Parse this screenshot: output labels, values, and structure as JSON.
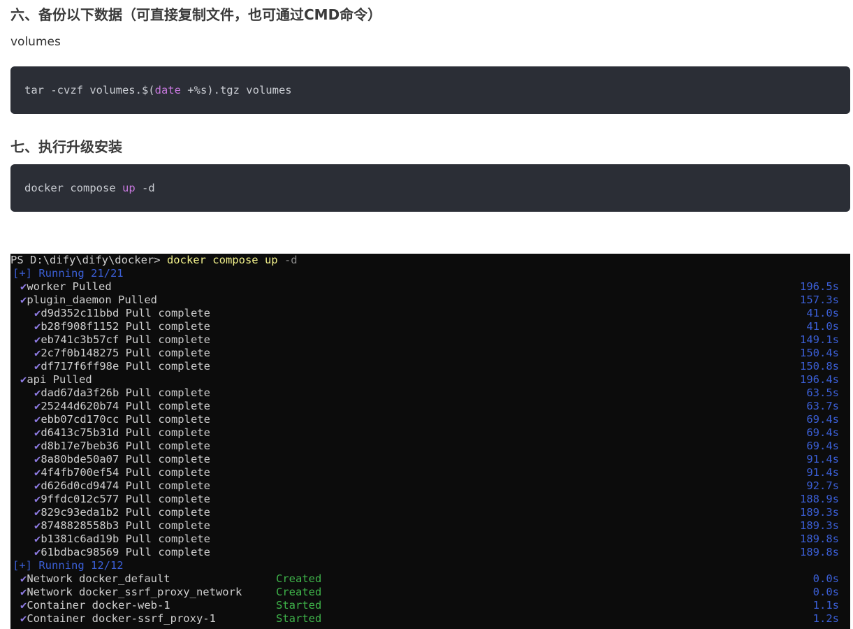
{
  "sections": {
    "six_heading": "六、备份以下数据（可直接复制文件，也可通过CMD命令）",
    "six_para": "volumes",
    "six_code": {
      "before": "tar -cvzf volumes.$(",
      "keyword": "date",
      "after": " +%s).tgz volumes"
    },
    "seven_heading": "七、执行升级安装",
    "seven_code": {
      "before": "docker compose ",
      "keyword": "up",
      "after": " -d"
    }
  },
  "terminal": {
    "prompt_path": "PS D:\\dify\\dify\\docker> ",
    "prompt_cmd": "docker compose up",
    "prompt_flag": " -d",
    "check": "✔",
    "running1": "[+] Running 21/21",
    "pull_items": [
      {
        "label": "worker Pulled",
        "time": "196.5s",
        "level": 1
      },
      {
        "label": "plugin_daemon Pulled",
        "time": "157.3s",
        "level": 1
      },
      {
        "label": "d9d352c11bbd Pull complete",
        "time": "41.0s",
        "level": 2
      },
      {
        "label": "b28f908f1152 Pull complete",
        "time": "41.0s",
        "level": 2
      },
      {
        "label": "eb741c3b57cf Pull complete",
        "time": "149.1s",
        "level": 2
      },
      {
        "label": "2c7f0b148275 Pull complete",
        "time": "150.4s",
        "level": 2
      },
      {
        "label": "df717f6ff98e Pull complete",
        "time": "150.8s",
        "level": 2
      },
      {
        "label": "api Pulled",
        "time": "196.4s",
        "level": 1
      },
      {
        "label": "dad67da3f26b Pull complete",
        "time": "63.5s",
        "level": 2
      },
      {
        "label": "25244d620b74 Pull complete",
        "time": "63.7s",
        "level": 2
      },
      {
        "label": "ebb07cd170cc Pull complete",
        "time": "69.4s",
        "level": 2
      },
      {
        "label": "d6413c75b31d Pull complete",
        "time": "69.4s",
        "level": 2
      },
      {
        "label": "d8b17e7beb36 Pull complete",
        "time": "69.4s",
        "level": 2
      },
      {
        "label": "8a80bde50a07 Pull complete",
        "time": "91.4s",
        "level": 2
      },
      {
        "label": "4f4fb700ef54 Pull complete",
        "time": "91.4s",
        "level": 2
      },
      {
        "label": "d626d0cd9474 Pull complete",
        "time": "92.7s",
        "level": 2
      },
      {
        "label": "9ffdc012c577 Pull complete",
        "time": "188.9s",
        "level": 2
      },
      {
        "label": "829c93eda1b2 Pull complete",
        "time": "189.3s",
        "level": 2
      },
      {
        "label": "8748828558b3 Pull complete",
        "time": "189.3s",
        "level": 2
      },
      {
        "label": "b1381c6ad19b Pull complete",
        "time": "189.8s",
        "level": 2
      },
      {
        "label": "61bdbac98569 Pull complete",
        "time": "189.8s",
        "level": 2
      }
    ],
    "running2": "[+] Running 12/12",
    "start_items": [
      {
        "label": "Network docker_default",
        "status": "Created",
        "time": "0.0s"
      },
      {
        "label": "Network docker_ssrf_proxy_network",
        "status": "Created",
        "time": "0.0s"
      },
      {
        "label": "Container docker-web-1",
        "status": "Started",
        "time": "1.1s"
      },
      {
        "label": "Container docker-ssrf_proxy-1",
        "status": "Started",
        "time": "1.2s"
      }
    ]
  }
}
